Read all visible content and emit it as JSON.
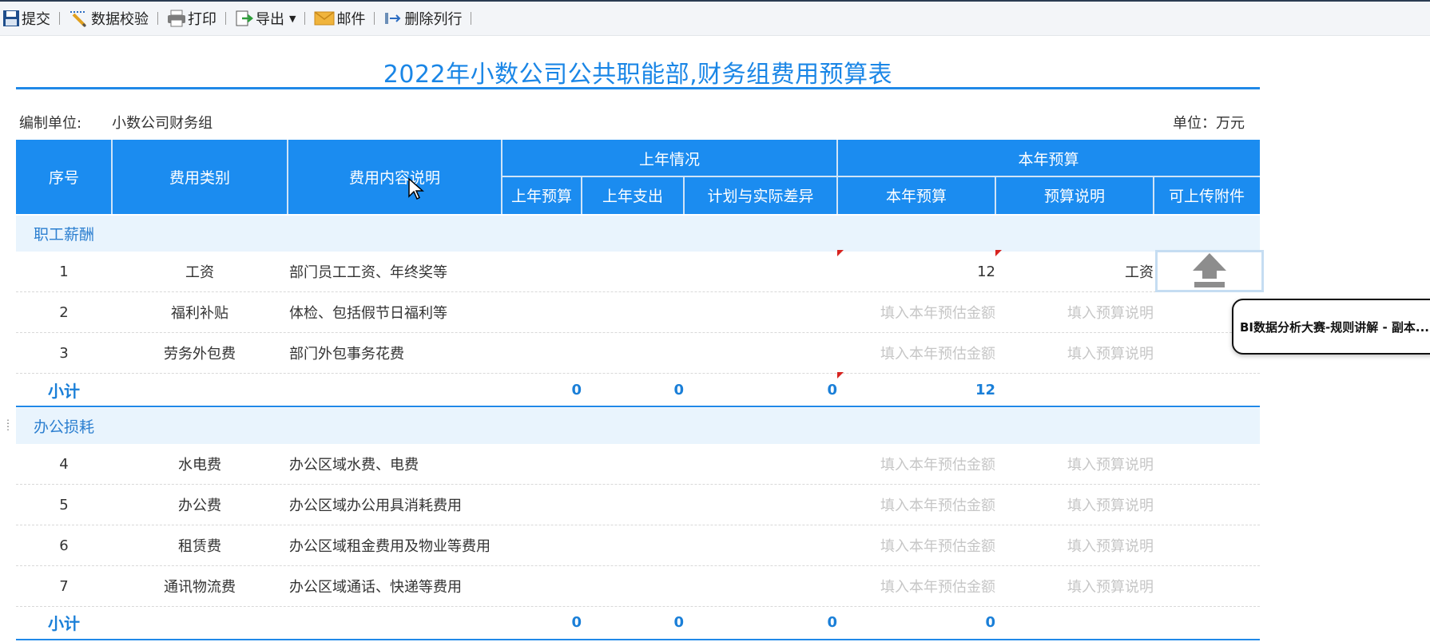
{
  "toolbar": {
    "submit": "提交",
    "validate": "数据校验",
    "print": "打印",
    "export": "导出",
    "mail": "邮件",
    "delete_row": "删除列行"
  },
  "report": {
    "title": "2022年小数公司公共职能部,财务组费用预算表",
    "unit_label": "编制单位:",
    "unit_value": "小数公司财务组",
    "currency_unit": "单位：万元"
  },
  "header": {
    "seq": "序号",
    "category": "费用类别",
    "description": "费用内容说明",
    "last_year_group": "上年情况",
    "this_year_group": "本年预算",
    "last_budget": "上年预算",
    "last_spend": "上年支出",
    "diff": "计划与实际差异",
    "this_budget": "本年预算",
    "budget_note": "预算说明",
    "attachment": "可上传附件"
  },
  "placeholders": {
    "amount": "填入本年预估金额",
    "note": "填入预算说明"
  },
  "groups": [
    {
      "name": "职工薪酬",
      "rows": [
        {
          "seq": "1",
          "category": "工资",
          "desc": "部门员工工资、年终奖等",
          "amount": "12",
          "note": "工资"
        },
        {
          "seq": "2",
          "category": "福利补贴",
          "desc": "体检、包括假节日福利等",
          "amount": "",
          "note": ""
        },
        {
          "seq": "3",
          "category": "劳务外包费",
          "desc": "部门外包事务花费",
          "amount": "",
          "note": ""
        }
      ],
      "subtotal": {
        "label": "小计",
        "last_budget": "0",
        "last_spend": "0",
        "diff": "0",
        "this_budget": "12"
      }
    },
    {
      "name": "办公损耗",
      "rows": [
        {
          "seq": "4",
          "category": "水电费",
          "desc": "办公区域水费、电费",
          "amount": "",
          "note": ""
        },
        {
          "seq": "5",
          "category": "办公费",
          "desc": "办公区域办公用具消耗费用",
          "amount": "",
          "note": ""
        },
        {
          "seq": "6",
          "category": "租赁费",
          "desc": "办公区域租金费用及物业等费用",
          "amount": "",
          "note": ""
        },
        {
          "seq": "7",
          "category": "通讯物流费",
          "desc": "办公区域通话、快递等费用",
          "amount": "",
          "note": ""
        }
      ],
      "subtotal": {
        "label": "小计",
        "last_budget": "0",
        "last_spend": "0",
        "diff": "0",
        "this_budget": "0"
      }
    }
  ],
  "popup": {
    "text": "BI数据分析大赛-规则讲解 - 副本..."
  },
  "colors": {
    "header_bg": "#1b8cf0",
    "accent": "#1a86e6",
    "group_bg": "#e9f4fd",
    "flag": "#d7231f"
  }
}
